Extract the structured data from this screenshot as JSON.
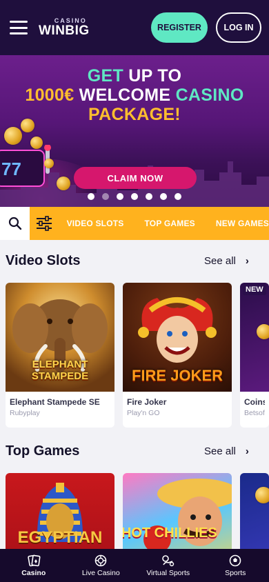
{
  "header": {
    "logo_small": "CASINO",
    "logo_big": "WINBIG",
    "register_label": "REGISTER",
    "login_label": "LOG IN"
  },
  "banner": {
    "line1_a": "GET",
    "line1_b": "UP TO",
    "line2_a": "1000€",
    "line2_b": "WELCOME",
    "line2_c": "CASINO",
    "line3": "PACKAGE!",
    "cta_label": "CLAIM NOW",
    "slide_count": 7,
    "active_slide": 1,
    "colors": {
      "teal": "#5fe8c3",
      "gold": "#ffbe2e",
      "cta": "#d6176d"
    }
  },
  "categories": {
    "tabs": [
      "VIDEO SLOTS",
      "TOP GAMES",
      "NEW GAMES"
    ],
    "bar_color": "#ffb21e"
  },
  "video_slots": {
    "title": "Video Slots",
    "see_all": "See all",
    "games": [
      {
        "name": "Elephant Stampede SE",
        "provider": "Rubyplay",
        "art_text": "ELEPHANT STAMPEDE"
      },
      {
        "name": "Fire Joker",
        "provider": "Play'n GO",
        "art_text": "FIRE JOKER"
      },
      {
        "name": "Coins",
        "provider": "Betsof",
        "badge": "NEW"
      }
    ]
  },
  "top_games": {
    "title": "Top Games",
    "see_all": "See all",
    "games": [
      {
        "art_text": "EGYPTIAN"
      },
      {
        "art_text": "3 HOT CHILLIES"
      },
      {
        "art_text": ""
      }
    ]
  },
  "bottom_nav": {
    "items": [
      {
        "label": "Casino",
        "icon": "cards-icon",
        "active": true
      },
      {
        "label": "Live Casino",
        "icon": "roulette-icon",
        "active": false
      },
      {
        "label": "Virtual Sports",
        "icon": "virtual-sports-icon",
        "active": false
      },
      {
        "label": "Sports",
        "icon": "soccer-ball-icon",
        "active": false
      }
    ]
  }
}
